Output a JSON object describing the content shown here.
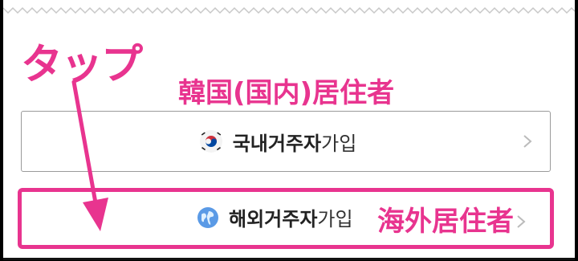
{
  "annotations": {
    "tap": "タップ",
    "korea_resident": "韓国(国内)居住者",
    "overseas_resident": "海外居住者"
  },
  "buttons": {
    "domestic": {
      "bold": "국내거주자",
      "light": "가입"
    },
    "overseas": {
      "bold": "해외거주자",
      "light": "가입"
    }
  },
  "colors": {
    "annotation_pink": "#e8348f",
    "border_gray": "#9a9a9a",
    "text_dark": "#222222"
  }
}
